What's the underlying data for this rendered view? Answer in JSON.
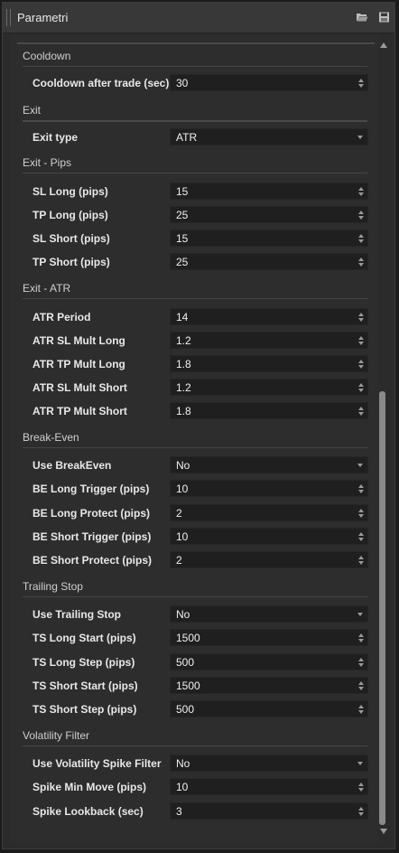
{
  "window": {
    "title": "Parametri"
  },
  "icons": {
    "open": "folder-open-icon",
    "save": "save-disk-icon"
  },
  "colors": {
    "panel_bg": "#2d2d2d",
    "field_bg": "#1f1f1f",
    "titlebar_bg": "#383838"
  },
  "sections": [
    {
      "title": "Cooldown",
      "rows": [
        {
          "label": "Cooldown after trade (sec)",
          "value": "30",
          "control": "spinner"
        }
      ]
    },
    {
      "title": "Exit",
      "rows": [
        {
          "label": "Exit type",
          "value": "ATR",
          "control": "dropdown"
        }
      ]
    },
    {
      "title": "Exit - Pips",
      "rows": [
        {
          "label": "SL Long (pips)",
          "value": "15",
          "control": "spinner"
        },
        {
          "label": "TP Long (pips)",
          "value": "25",
          "control": "spinner"
        },
        {
          "label": "SL Short (pips)",
          "value": "15",
          "control": "spinner"
        },
        {
          "label": "TP Short (pips)",
          "value": "25",
          "control": "spinner"
        }
      ]
    },
    {
      "title": "Exit - ATR",
      "rows": [
        {
          "label": "ATR Period",
          "value": "14",
          "control": "spinner"
        },
        {
          "label": "ATR SL Mult Long",
          "value": "1.2",
          "control": "spinner"
        },
        {
          "label": "ATR TP Mult Long",
          "value": "1.8",
          "control": "spinner"
        },
        {
          "label": "ATR SL Mult Short",
          "value": "1.2",
          "control": "spinner"
        },
        {
          "label": "ATR TP Mult Short",
          "value": "1.8",
          "control": "spinner"
        }
      ]
    },
    {
      "title": "Break-Even",
      "rows": [
        {
          "label": "Use BreakEven",
          "value": "No",
          "control": "dropdown"
        },
        {
          "label": "BE Long Trigger (pips)",
          "value": "10",
          "control": "spinner"
        },
        {
          "label": "BE Long Protect (pips)",
          "value": "2",
          "control": "spinner"
        },
        {
          "label": "BE Short Trigger (pips)",
          "value": "10",
          "control": "spinner"
        },
        {
          "label": "BE Short Protect (pips)",
          "value": "2",
          "control": "spinner"
        }
      ]
    },
    {
      "title": "Trailing Stop",
      "rows": [
        {
          "label": "Use Trailing Stop",
          "value": "No",
          "control": "dropdown"
        },
        {
          "label": "TS Long Start (pips)",
          "value": "1500",
          "control": "spinner"
        },
        {
          "label": "TS Long Step (pips)",
          "value": "500",
          "control": "spinner"
        },
        {
          "label": "TS Short Start (pips)",
          "value": "1500",
          "control": "spinner"
        },
        {
          "label": "TS Short Step (pips)",
          "value": "500",
          "control": "spinner"
        }
      ]
    },
    {
      "title": "Volatility Filter",
      "rows": [
        {
          "label": "Use Volatility Spike Filter",
          "value": "No",
          "control": "dropdown"
        },
        {
          "label": "Spike Min Move (pips)",
          "value": "10",
          "control": "spinner"
        },
        {
          "label": "Spike Lookback (sec)",
          "value": "3",
          "control": "spinner"
        }
      ]
    }
  ]
}
